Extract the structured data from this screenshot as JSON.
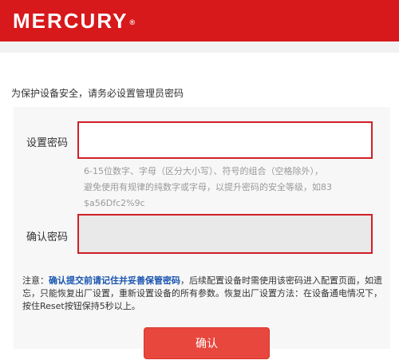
{
  "brand": {
    "logo": "MERCURY",
    "logo_mark": "®",
    "color": "#d7191c"
  },
  "intro": "为保护设备安全，请务必设置管理员密码",
  "form": {
    "password_label": "设置密码",
    "password_value": "",
    "hint_lines": [
      "6-15位数字、字母（区分大小写）、符号的组合（空格除外），",
      "避免使用有规律的纯数字或字母，以提升密码的安全等级，如83",
      "$a56Dfc2%9c"
    ],
    "confirm_label": "确认密码",
    "confirm_value": "",
    "error_border_color": "#d11f26"
  },
  "note": {
    "prefix": "注意：",
    "emphasis": "确认提交前请记住并妥善保管密码",
    "rest": "，后续配置设备时需使用该密码进入配置页面，如遗忘，只能恢复出厂设置，重新设置设备的所有参数。恢复出厂设置方法：在设备通电情况下，按住Reset按钮保持5秒以上。"
  },
  "submit_label": "确认"
}
